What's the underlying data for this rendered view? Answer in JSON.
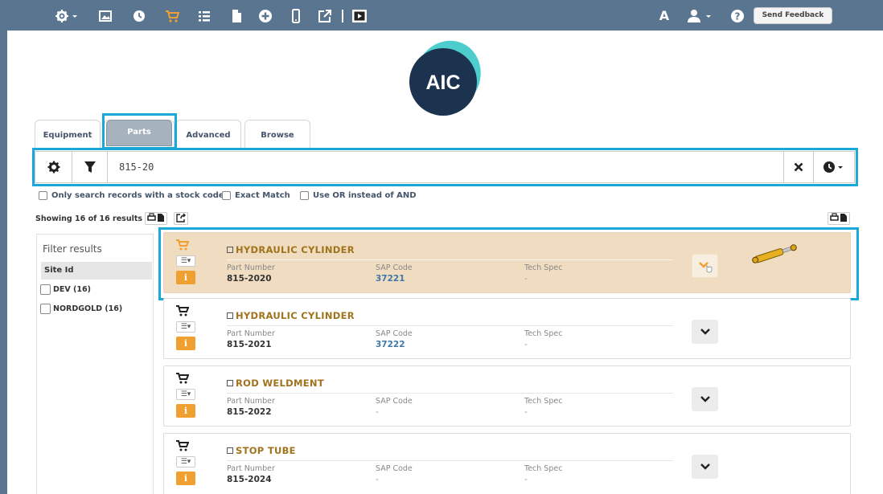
{
  "toolbar": {
    "feedback_label": "Send Feedback",
    "font_label": "A",
    "icons": [
      "gear-icon",
      "image-icon",
      "clock-icon",
      "cart-icon",
      "list-icon",
      "document-icon",
      "plus-circle-icon",
      "mobile-icon",
      "external-link-icon",
      "video-icon",
      "user-icon",
      "help-icon"
    ]
  },
  "logo": {
    "text": "AIC"
  },
  "tabs": [
    {
      "label": "Equipment",
      "active": false
    },
    {
      "label": "Parts",
      "active": true
    },
    {
      "label": "Advanced",
      "active": false
    },
    {
      "label": "Browse",
      "active": false
    }
  ],
  "search": {
    "value": "815-20"
  },
  "options": {
    "stock_code": "Only search records with a stock code",
    "exact_match": "Exact Match",
    "use_or": "Use OR instead of AND"
  },
  "results": {
    "summary": "Showing 16 of 16 results"
  },
  "filter": {
    "title": "Filter results",
    "group_label": "Site Id",
    "facets": [
      {
        "label": "DEV (16)"
      },
      {
        "label": "NORDGOLD (16)"
      }
    ]
  },
  "field_labels": {
    "part_number": "Part Number",
    "sap_code": "SAP Code",
    "tech_spec": "Tech Spec"
  },
  "items": [
    {
      "title": "HYDRAULIC CYLINDER",
      "part_number": "815-2020",
      "sap_code": "37221",
      "tech_spec": "-",
      "selected": true
    },
    {
      "title": "HYDRAULIC CYLINDER",
      "part_number": "815-2021",
      "sap_code": "37222",
      "tech_spec": "-",
      "selected": false
    },
    {
      "title": "ROD WELDMENT",
      "part_number": "815-2022",
      "sap_code": "-",
      "tech_spec": "-",
      "selected": false
    },
    {
      "title": "STOP TUBE",
      "part_number": "815-2024",
      "sap_code": "-",
      "tech_spec": "-",
      "selected": false
    }
  ],
  "colors": {
    "toolbar_bg": "#5a7590",
    "highlight": "#1aa8d8",
    "accent_orange": "#f0a030",
    "title_gold": "#a0731d",
    "link_blue": "#3f77a8",
    "selected_row": "#f0dcc0"
  }
}
